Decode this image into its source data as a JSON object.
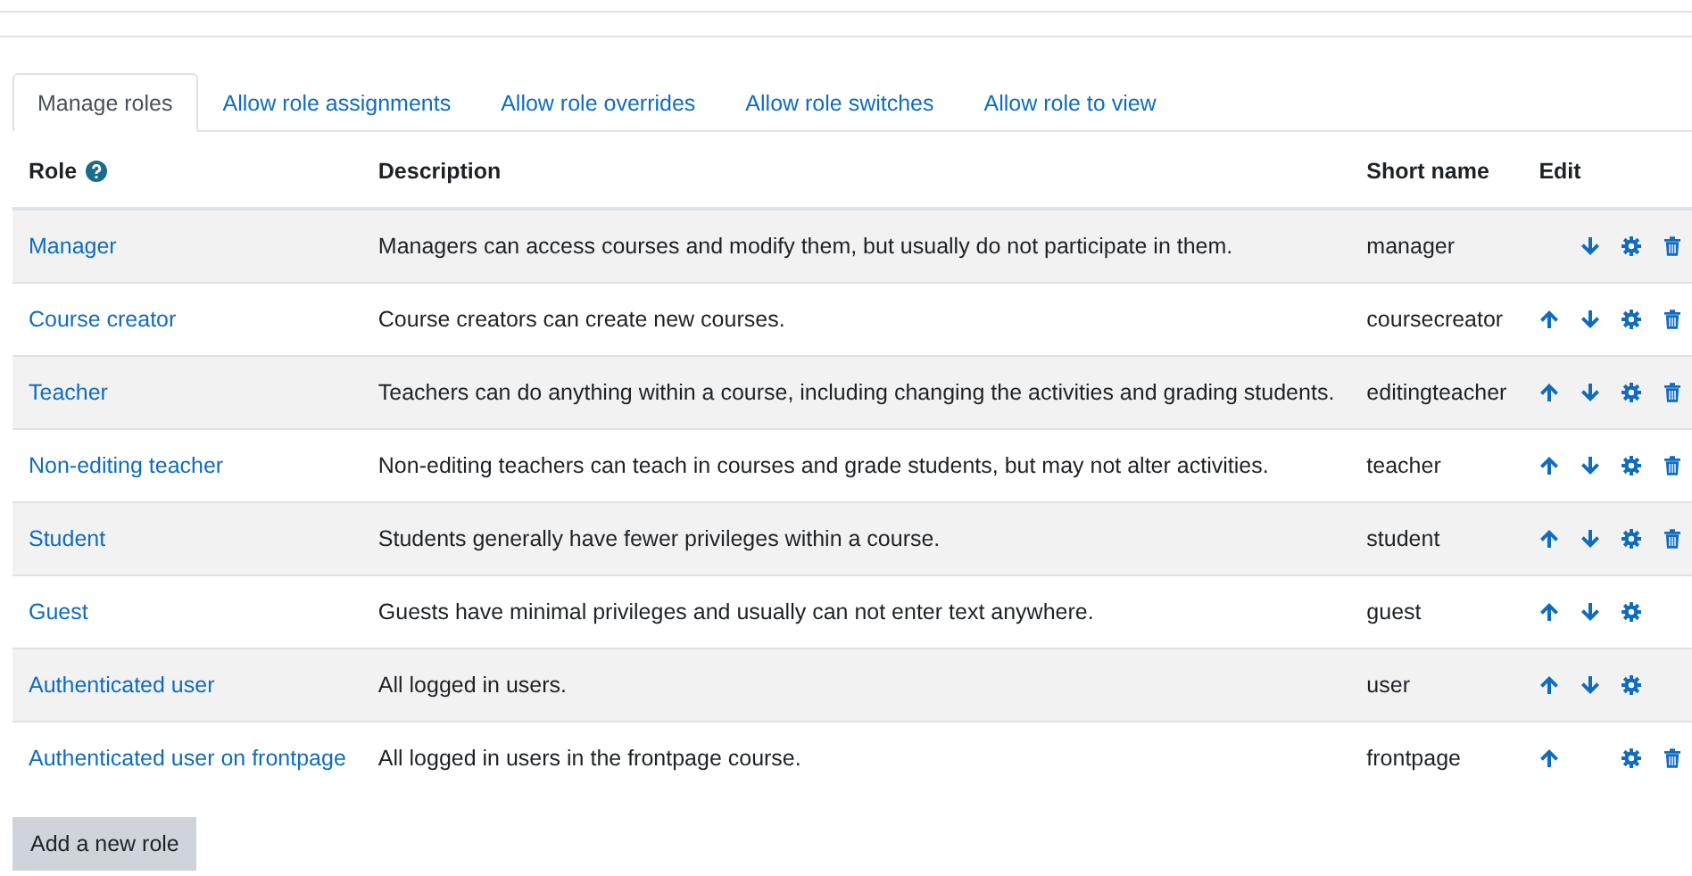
{
  "tabs": [
    {
      "label": "Manage roles",
      "selected": true
    },
    {
      "label": "Allow role assignments",
      "selected": false
    },
    {
      "label": "Allow role overrides",
      "selected": false
    },
    {
      "label": "Allow role switches",
      "selected": false
    },
    {
      "label": "Allow role to view",
      "selected": false
    }
  ],
  "table": {
    "columns": [
      "Role",
      "Description",
      "Short name",
      "Edit"
    ],
    "rows": [
      {
        "role": "Manager",
        "description": "Managers can access courses and modify them, but usually do not participate in them.",
        "short_name": "manager",
        "move_up": false,
        "move_down": true,
        "edit": true,
        "delete": true
      },
      {
        "role": "Course creator",
        "description": "Course creators can create new courses.",
        "short_name": "coursecreator",
        "move_up": true,
        "move_down": true,
        "edit": true,
        "delete": true
      },
      {
        "role": "Teacher",
        "description": "Teachers can do anything within a course, including changing the activities and grading students.",
        "short_name": "editingteacher",
        "move_up": true,
        "move_down": true,
        "edit": true,
        "delete": true
      },
      {
        "role": "Non-editing teacher",
        "description": "Non-editing teachers can teach in courses and grade students, but may not alter activities.",
        "short_name": "teacher",
        "move_up": true,
        "move_down": true,
        "edit": true,
        "delete": true
      },
      {
        "role": "Student",
        "description": "Students generally have fewer privileges within a course.",
        "short_name": "student",
        "move_up": true,
        "move_down": true,
        "edit": true,
        "delete": true
      },
      {
        "role": "Guest",
        "description": "Guests have minimal privileges and usually can not enter text anywhere.",
        "short_name": "guest",
        "move_up": true,
        "move_down": true,
        "edit": true,
        "delete": false
      },
      {
        "role": "Authenticated user",
        "description": "All logged in users.",
        "short_name": "user",
        "move_up": true,
        "move_down": true,
        "edit": true,
        "delete": false
      },
      {
        "role": "Authenticated user on frontpage",
        "description": "All logged in users in the frontpage course.",
        "short_name": "frontpage",
        "move_up": true,
        "move_down": false,
        "edit": true,
        "delete": true
      }
    ]
  },
  "add_button": "Add a new role"
}
